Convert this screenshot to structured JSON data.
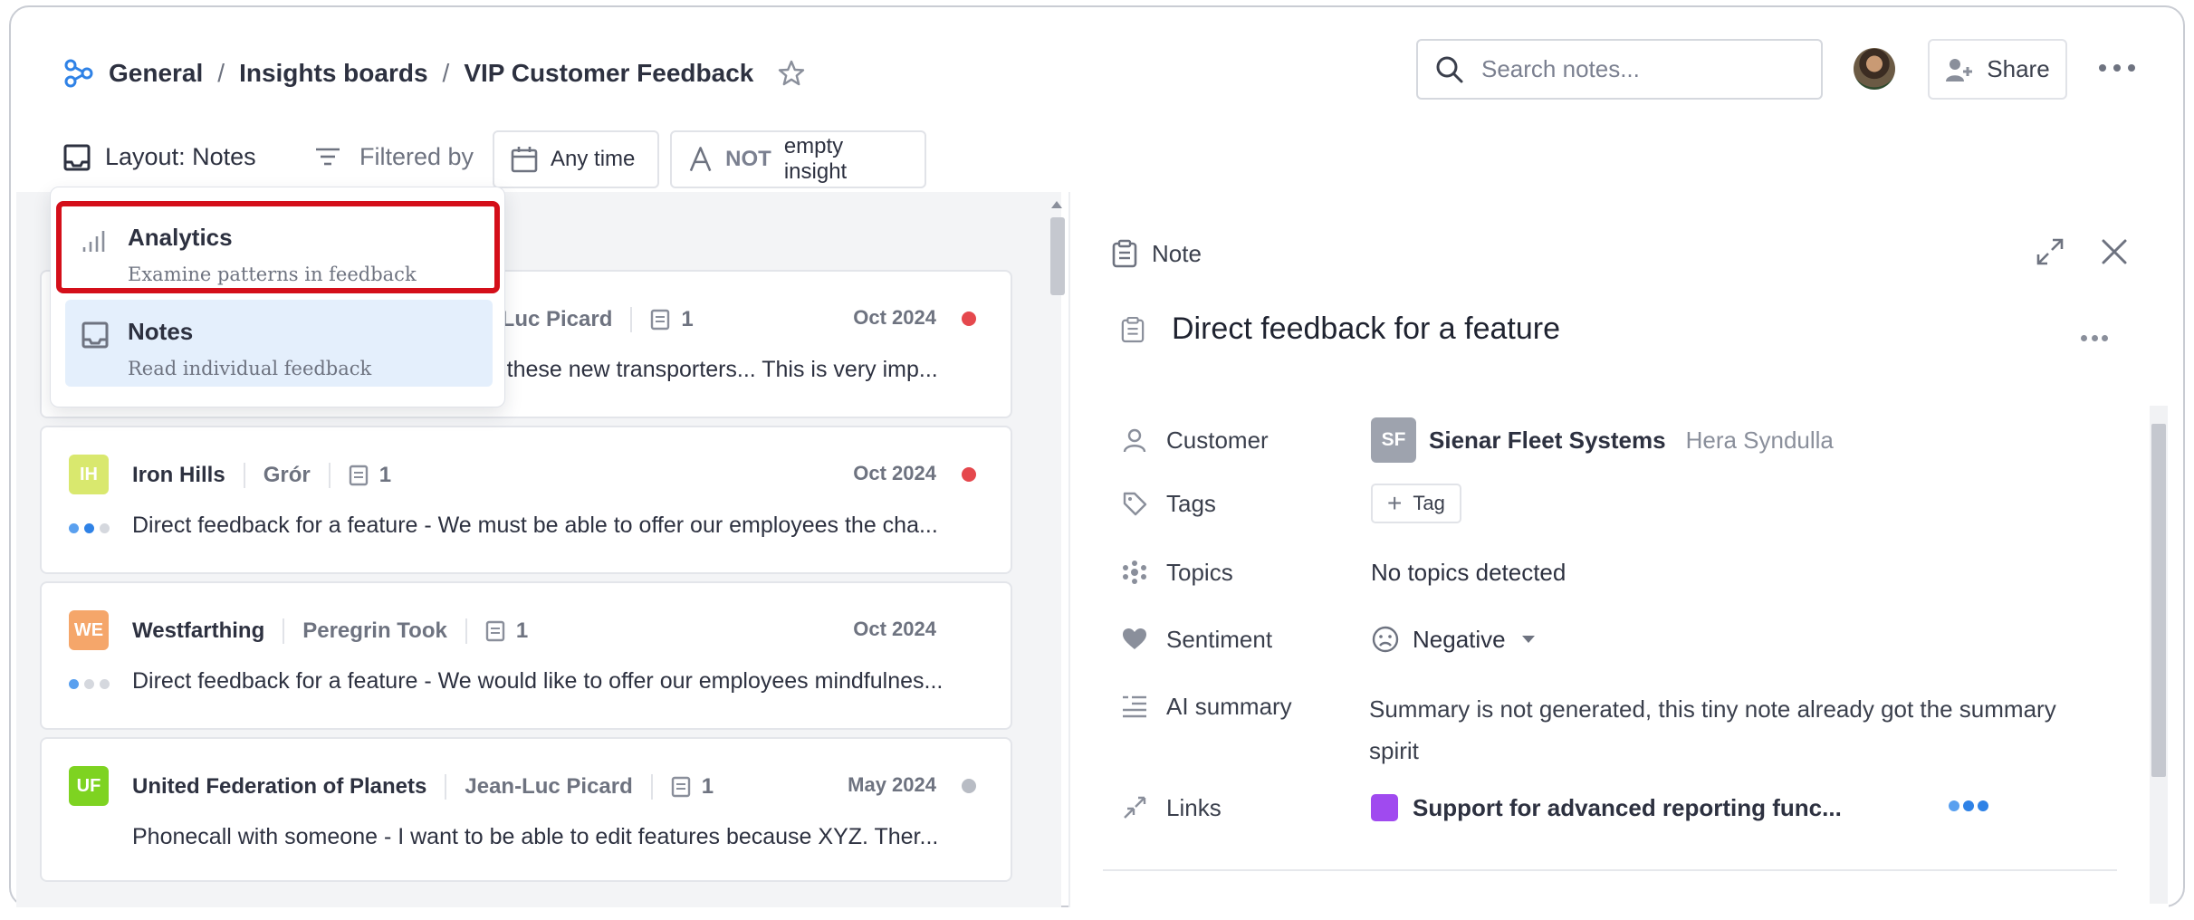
{
  "breadcrumb": {
    "items": [
      "General",
      "Insights boards",
      "VIP Customer Feedback"
    ],
    "separator": "/"
  },
  "search": {
    "placeholder": "Search notes..."
  },
  "share": {
    "label": "Share"
  },
  "toolbar": {
    "layout_label": "Layout: Notes",
    "filtered_label": "Filtered by",
    "chip_time": "Any time",
    "chip_insight_not": "NOT",
    "chip_insight_label": "empty insight"
  },
  "layout_menu": {
    "items": [
      {
        "title": "Analytics",
        "description": "Examine patterns in feedback",
        "icon": "bar-chart-icon",
        "selected": false
      },
      {
        "title": "Notes",
        "description": "Read individual feedback",
        "icon": "inbox-icon",
        "selected": true
      }
    ]
  },
  "notes": [
    {
      "badge": "",
      "badge_color": "#9ea3ae",
      "company": "",
      "person": "Jean-Luc Picard",
      "person_visible": "n-Luc Picard",
      "count": "1",
      "date": "Oct 2024",
      "status_color": "#e5484d",
      "text": "rust these new transporters... This is very imp...",
      "progress_dots": []
    },
    {
      "badge": "IH",
      "badge_color": "#d9e86e",
      "company": "Iron Hills",
      "person": "Grór",
      "count": "1",
      "date": "Oct 2024",
      "status_color": "#e5484d",
      "text": "Direct feedback for a feature - We must be able to offer our employees the cha...",
      "progress_dots": [
        "#5aa0ef",
        "#2f82e6",
        "#d5d8de"
      ]
    },
    {
      "badge": "WE",
      "badge_color": "#f5a66a",
      "company": "Westfarthing",
      "person": "Peregrin Took",
      "count": "1",
      "date": "Oct 2024",
      "status_color": "",
      "text": "Direct feedback for a feature - We would like to offer our employees mindfulnes...",
      "progress_dots": [
        "#5aa0ef",
        "#d5d8de",
        "#d5d8de"
      ]
    },
    {
      "badge": "UF",
      "badge_color": "#7ed321",
      "company": "United Federation of Planets",
      "person": "Jean-Luc Picard",
      "count": "1",
      "date": "May 2024",
      "status_color": "#b8bcc4",
      "text": "Phonecall with someone - I want to be able to edit features because XYZ. Ther...",
      "progress_dots": []
    }
  ],
  "note_detail": {
    "header_label": "Note",
    "title": "Direct feedback for a feature",
    "fields": {
      "customer_label": "Customer",
      "customer_badge": "SF",
      "customer_company": "Sienar Fleet Systems",
      "customer_person": "Hera Syndulla",
      "tags_label": "Tags",
      "tag_button": "Tag",
      "topics_label": "Topics",
      "topics_value": "No topics detected",
      "sentiment_label": "Sentiment",
      "sentiment_value": "Negative",
      "ai_summary_label": "AI summary",
      "ai_summary_value": "Summary is not generated, this tiny note already got the summary spirit",
      "links_label": "Links",
      "link_value": "Support for advanced reporting func..."
    }
  },
  "colors": {
    "accent_blue": "#2f82e6",
    "highlight_red": "#d40f1a",
    "selected_bg": "#e4effc",
    "link_purple": "#a04aef"
  }
}
